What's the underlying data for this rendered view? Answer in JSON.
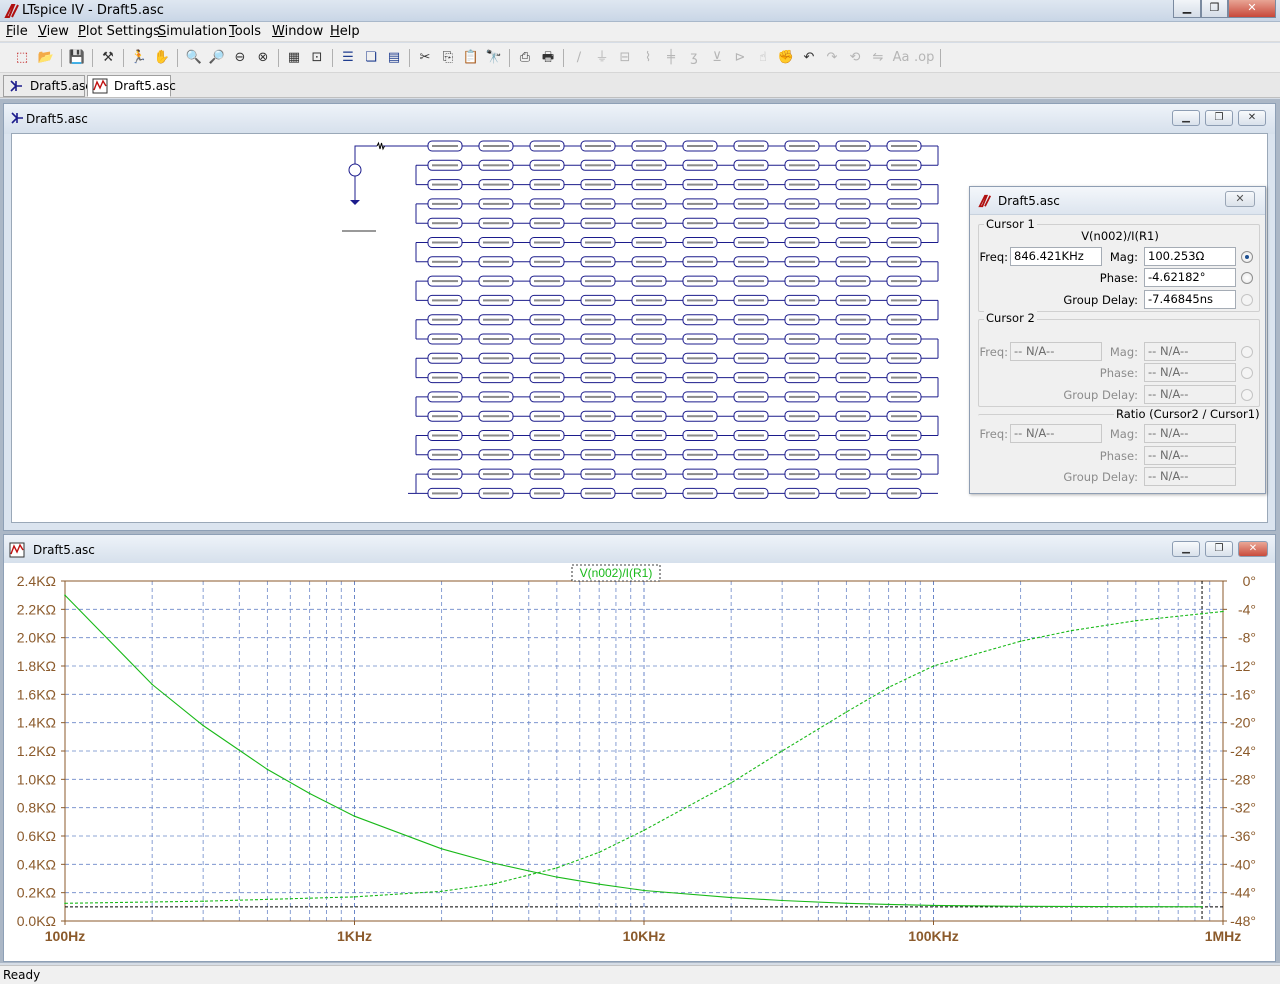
{
  "window": {
    "title": "LTspice IV - Draft5.asc"
  },
  "menu": [
    {
      "label": "File",
      "u": "F",
      "rest": "ile"
    },
    {
      "label": "View",
      "u": "V",
      "rest": "iew"
    },
    {
      "label": "Plot Settings",
      "u": "P",
      "rest": "lot Settings"
    },
    {
      "label": "Simulation",
      "u": "S",
      "rest": "imulation"
    },
    {
      "label": "Tools",
      "u": "T",
      "rest": "ools"
    },
    {
      "label": "Window",
      "u": "W",
      "rest": "indow"
    },
    {
      "label": "Help",
      "u": "H",
      "rest": "elp"
    }
  ],
  "tabs": [
    {
      "label": "Draft5.asc",
      "icon": "schematic-icon"
    },
    {
      "label": "Draft5.asc",
      "icon": "waveform-icon",
      "active": true
    }
  ],
  "schematic_window": {
    "title": "Draft5.asc"
  },
  "plot_window": {
    "title": "Draft5.asc",
    "trace_label": "V(n002)/I(R1)"
  },
  "cursor_dialog": {
    "title": "Draft5.asc",
    "cursor1": {
      "group": "Cursor 1",
      "expression": "V(n002)/I(R1)",
      "freq_label": "Freq:",
      "freq": "846.421KHz",
      "mag_label": "Mag:",
      "mag": "100.253Ω",
      "phase_label": "Phase:",
      "phase": "-4.62182°",
      "gd_label": "Group Delay:",
      "gd": "-7.46845ns"
    },
    "cursor2": {
      "group": "Cursor 2",
      "freq_label": "Freq:",
      "freq": "-- N/A--",
      "mag_label": "Mag:",
      "mag": "-- N/A--",
      "phase_label": "Phase:",
      "phase": "-- N/A--",
      "gd_label": "Group Delay:",
      "gd": "-- N/A--"
    },
    "ratio": {
      "group": "Ratio (Cursor2 / Cursor1)",
      "freq_label": "Freq:",
      "freq": "-- N/A--",
      "mag_label": "Mag:",
      "mag": "-- N/A--",
      "phase_label": "Phase:",
      "phase": "-- N/A--",
      "gd_label": "Group Delay:",
      "gd": "-- N/A--"
    }
  },
  "status": "Ready",
  "colors": {
    "trace": "#19b919",
    "axis": "#8b5a2b",
    "grid": "#6a86c8",
    "schematic_wire": "#1c1c8c"
  },
  "chart_data": {
    "type": "line",
    "title": "V(n002)/I(R1)",
    "x_scale": "log",
    "x_range": [
      100,
      1000000
    ],
    "x_ticks": [
      "100Hz",
      "1KHz",
      "10KHz",
      "100KHz",
      "1MHz"
    ],
    "y_left_range": [
      0,
      2400
    ],
    "y_left_ticks": [
      "0.0KΩ",
      "0.2KΩ",
      "0.4KΩ",
      "0.6KΩ",
      "0.8KΩ",
      "1.0KΩ",
      "1.2KΩ",
      "1.4KΩ",
      "1.6KΩ",
      "1.8KΩ",
      "2.0KΩ",
      "2.2KΩ",
      "2.4KΩ"
    ],
    "y_right_range": [
      -48,
      0
    ],
    "y_right_ticks": [
      "0°",
      "-4°",
      "-8°",
      "-12°",
      "-16°",
      "-20°",
      "-24°",
      "-28°",
      "-32°",
      "-36°",
      "-40°",
      "-44°",
      "-48°"
    ],
    "grid": true,
    "series": [
      {
        "name": "V(n002)/I(R1)",
        "style": "solid",
        "axis": "left",
        "x": [
          100,
          200,
          300,
          500,
          700,
          1000,
          2000,
          3000,
          5000,
          7000,
          10000,
          20000,
          30000,
          50000,
          70000,
          100000,
          200000,
          500000,
          846421
        ],
        "y": [
          2300,
          1670,
          1380,
          1070,
          900,
          740,
          510,
          410,
          310,
          260,
          215,
          165,
          145,
          125,
          117,
          110,
          104,
          101,
          100.253
        ]
      },
      {
        "name": "phase",
        "style": "dashed",
        "axis": "right",
        "x": [
          100,
          300,
          1000,
          2000,
          3000,
          5000,
          7000,
          10000,
          20000,
          30000,
          50000,
          70000,
          100000,
          200000,
          300000,
          500000,
          846421,
          1000000
        ],
        "y": [
          -45.5,
          -45.2,
          -44.6,
          -43.8,
          -42.8,
          -40.5,
          -38.3,
          -35.2,
          -28.5,
          -24.0,
          -18.5,
          -15.0,
          -12.0,
          -8.5,
          -7.0,
          -5.6,
          -4.62182,
          -4.3
        ]
      }
    ],
    "cursor_x": 846421,
    "ref_y": 100
  }
}
